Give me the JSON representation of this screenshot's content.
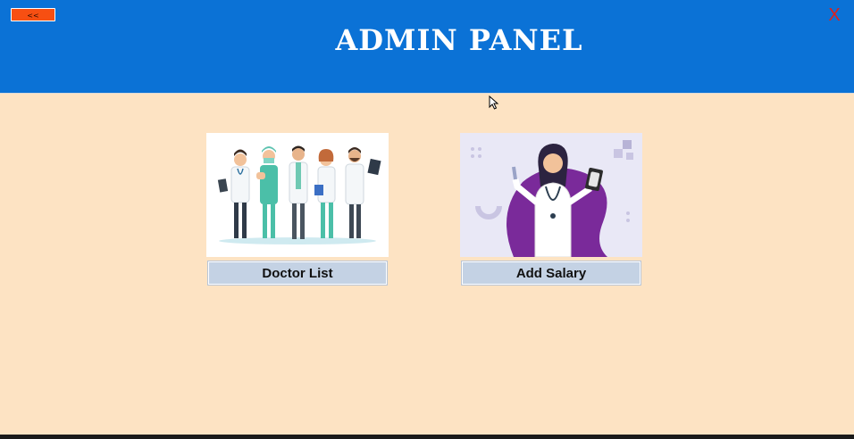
{
  "header": {
    "title": "ADMIN PANEL",
    "back_label": "<<",
    "close_label": "X"
  },
  "cards": [
    {
      "button_label": "Doctor List",
      "image": "doctors-group-illustration"
    },
    {
      "button_label": "Add Salary",
      "image": "doctor-holding-money-illustration"
    }
  ],
  "colors": {
    "header": "#0b72d6",
    "background": "#fde3c3",
    "back_button": "#f74f12",
    "close": "#e0201a",
    "card_button": "#c4d2e4"
  }
}
